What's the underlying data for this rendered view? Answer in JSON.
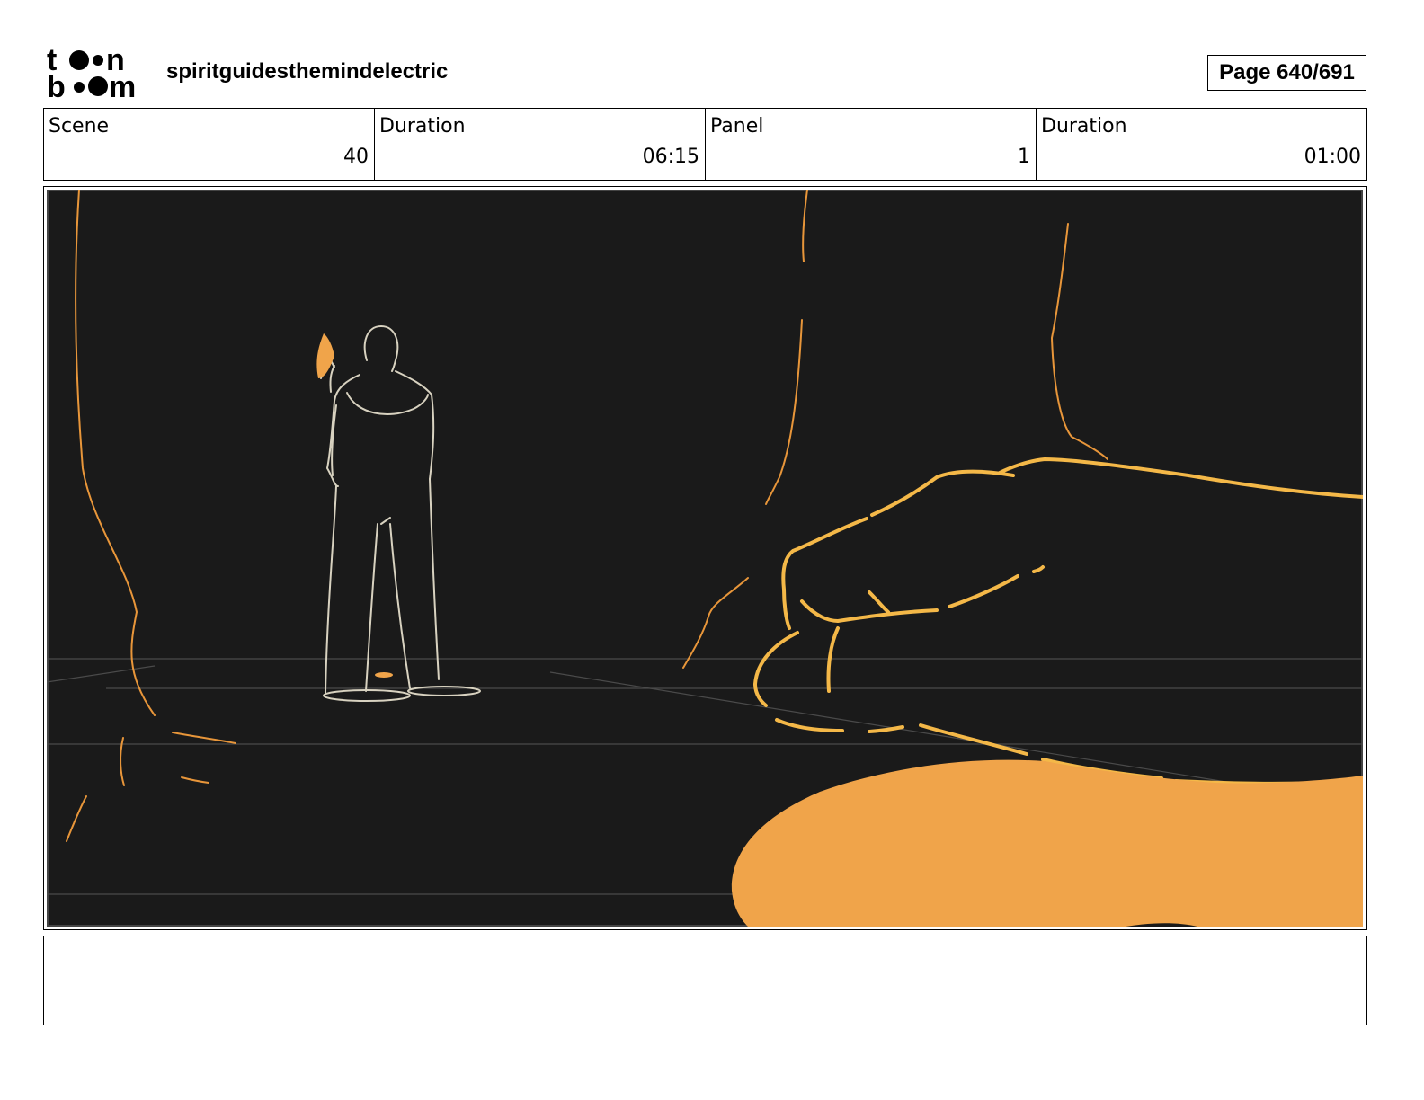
{
  "header": {
    "logo_text": "toon boom",
    "project_title": "spiritguidesthemindelectric",
    "page_label": "Page 640/691"
  },
  "info_table": {
    "cells": [
      {
        "label": "Scene",
        "value": "40"
      },
      {
        "label": "Duration",
        "value": "06:15"
      },
      {
        "label": "Panel",
        "value": "1"
      },
      {
        "label": "Duration",
        "value": "01:00"
      }
    ]
  },
  "panel": {
    "background_color": "#1a1a1a",
    "accent_color": "#f0a44a",
    "line_color": "#f4b848",
    "figure_color": "#d8d2c0"
  },
  "notes": {
    "text": ""
  }
}
